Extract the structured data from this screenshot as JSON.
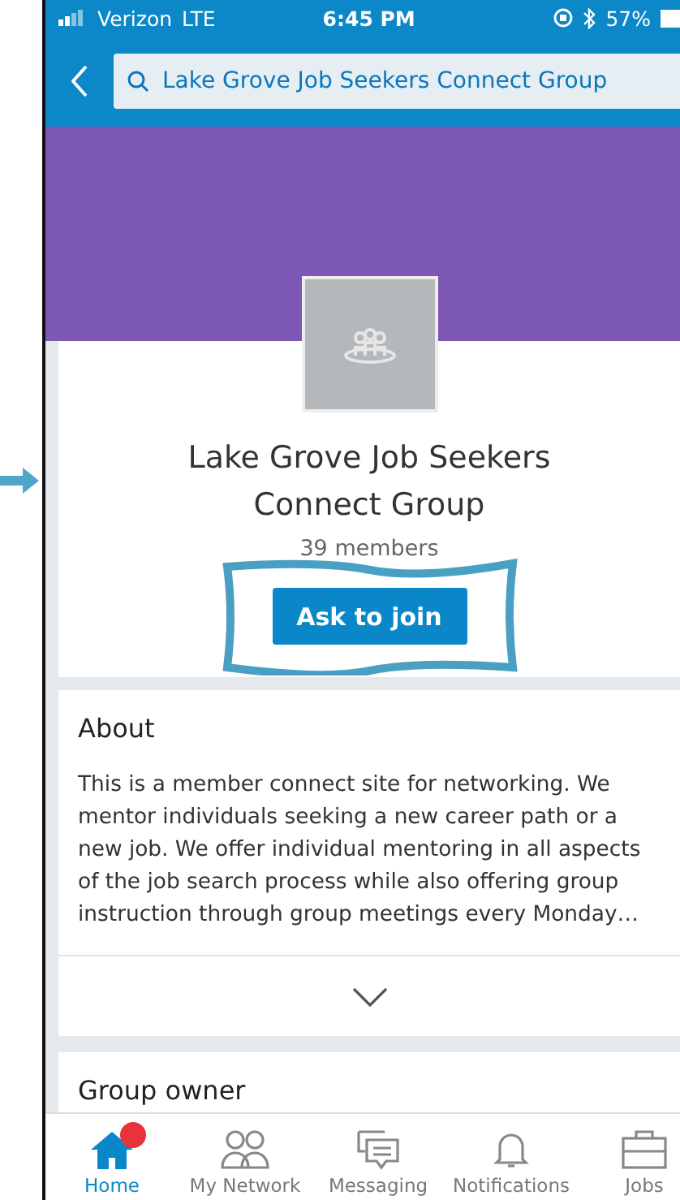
{
  "status_bar": {
    "carrier": "Verizon",
    "network": "LTE",
    "time": "6:45 PM",
    "battery": "57%"
  },
  "nav": {
    "search": {
      "value": "Lake Grove Job Seekers Connect Group"
    }
  },
  "group": {
    "name": "Lake Grove Job Seekers Connect Group",
    "members": "39 members",
    "action": "Ask to join",
    "highlighted": true
  },
  "about": {
    "title": "About",
    "text": "This is a member connect site for networking. We mentor individuals seeking a new career path or a new job. We offer individual mentoring in all aspects of the job search process while also offering group instruction through group meetings every Monday…",
    "expanded": false
  },
  "group_owner": {
    "title": "Group owner"
  },
  "tabs": [
    {
      "label": "Home",
      "kind": "home",
      "selected": true,
      "badge": true
    },
    {
      "label": "My Network",
      "kind": "network",
      "selected": false,
      "badge": false
    },
    {
      "label": "Messaging",
      "kind": "messaging",
      "selected": false,
      "badge": false
    },
    {
      "label": "Notifications",
      "kind": "notifications",
      "selected": false,
      "badge": false
    },
    {
      "label": "Jobs",
      "kind": "jobs",
      "selected": false,
      "badge": false
    }
  ]
}
